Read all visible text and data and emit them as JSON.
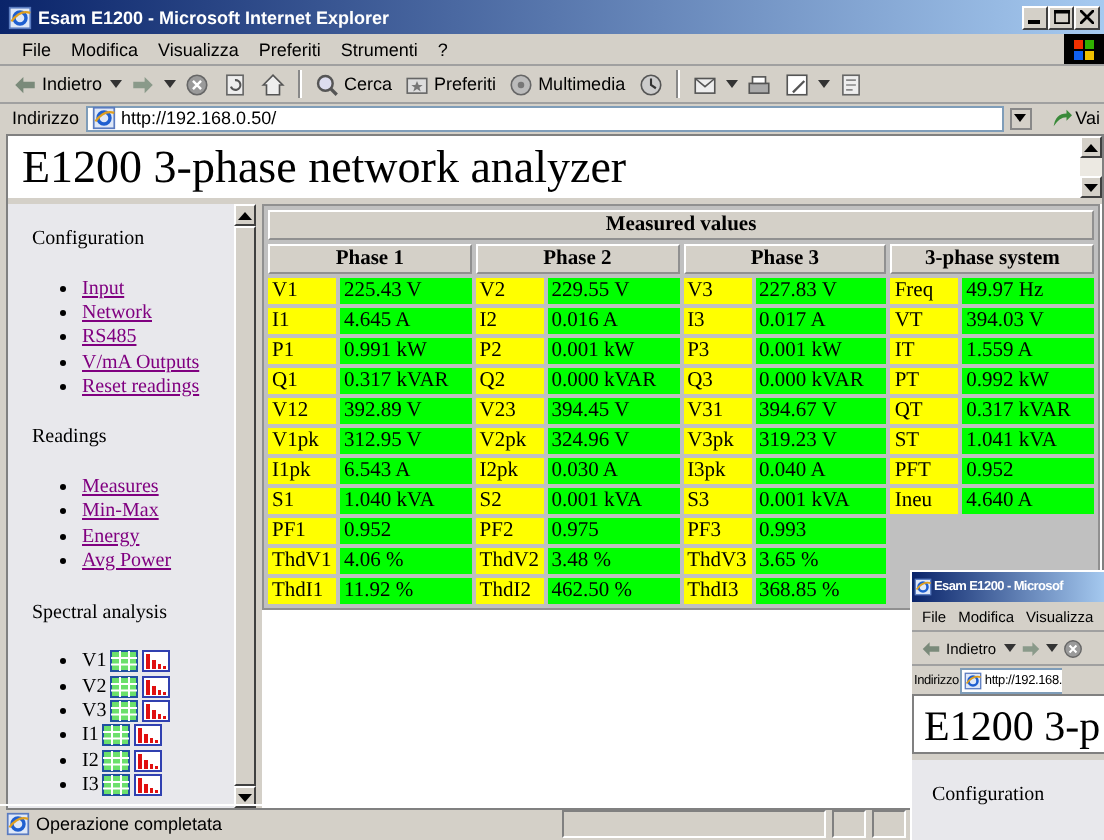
{
  "window": {
    "title": "Esam E1200 - Microsoft Internet Explorer",
    "menu": [
      "File",
      "Modifica",
      "Visualizza",
      "Preferiti",
      "Strumenti",
      "?"
    ],
    "toolbar": [
      {
        "kind": "back",
        "label": "Indietro"
      },
      {
        "kind": "forward"
      },
      {
        "kind": "stop"
      },
      {
        "kind": "refresh"
      },
      {
        "kind": "home"
      },
      {
        "kind": "search",
        "label": "Cerca"
      },
      {
        "kind": "favorites",
        "label": "Preferiti"
      },
      {
        "kind": "media",
        "label": "Multimedia"
      },
      {
        "kind": "history"
      },
      {
        "kind": "mail"
      },
      {
        "kind": "print"
      },
      {
        "kind": "edit"
      },
      {
        "kind": "discuss"
      }
    ],
    "address": {
      "label": "Indirizzo",
      "url": "http://192.168.0.50/",
      "go": "Vai"
    }
  },
  "page": {
    "heading": "E1200 3-phase network analyzer",
    "sidebar": [
      {
        "title": "Configuration",
        "links": [
          "Input",
          "Network",
          "RS485",
          "V/mA Outputs",
          "Reset readings"
        ]
      },
      {
        "title": "Readings",
        "links": [
          "Measures",
          "Min-Max",
          "Energy",
          "Avg Power"
        ]
      },
      {
        "title": "Spectral analysis",
        "channels": [
          "V1",
          "V2",
          "V3",
          "I1",
          "I2",
          "I3"
        ]
      }
    ],
    "table": {
      "title": "Measured values",
      "groups": [
        {
          "title": "Phase 1",
          "rows": [
            {
              "label": "V1",
              "value": "225.43 V"
            },
            {
              "label": "I1",
              "value": "4.645 A"
            },
            {
              "label": "P1",
              "value": "0.991 kW"
            },
            {
              "label": "Q1",
              "value": "0.317 kVAR"
            },
            {
              "label": "V12",
              "value": "392.89 V"
            },
            {
              "label": "V1pk",
              "value": "312.95 V"
            },
            {
              "label": "I1pk",
              "value": "6.543 A"
            },
            {
              "label": "S1",
              "value": "1.040 kVA"
            },
            {
              "label": "PF1",
              "value": "0.952"
            },
            {
              "label": "ThdV1",
              "value": "4.06 %"
            },
            {
              "label": "ThdI1",
              "value": "11.92 %"
            }
          ]
        },
        {
          "title": "Phase 2",
          "rows": [
            {
              "label": "V2",
              "value": "229.55 V"
            },
            {
              "label": "I2",
              "value": "0.016 A"
            },
            {
              "label": "P2",
              "value": "0.001 kW"
            },
            {
              "label": "Q2",
              "value": "0.000 kVAR"
            },
            {
              "label": "V23",
              "value": "394.45 V"
            },
            {
              "label": "V2pk",
              "value": "324.96 V"
            },
            {
              "label": "I2pk",
              "value": "0.030 A"
            },
            {
              "label": "S2",
              "value": "0.001 kVA"
            },
            {
              "label": "PF2",
              "value": "0.975"
            },
            {
              "label": "ThdV2",
              "value": "3.48 %"
            },
            {
              "label": "ThdI2",
              "value": "462.50 %"
            }
          ]
        },
        {
          "title": "Phase 3",
          "rows": [
            {
              "label": "V3",
              "value": "227.83 V"
            },
            {
              "label": "I3",
              "value": "0.017 A"
            },
            {
              "label": "P3",
              "value": "0.001 kW"
            },
            {
              "label": "Q3",
              "value": "0.000 kVAR"
            },
            {
              "label": "V31",
              "value": "394.67 V"
            },
            {
              "label": "V3pk",
              "value": "319.23 V"
            },
            {
              "label": "I3pk",
              "value": "0.040 A"
            },
            {
              "label": "S3",
              "value": "0.001 kVA"
            },
            {
              "label": "PF3",
              "value": "0.993"
            },
            {
              "label": "ThdV3",
              "value": "3.65 %"
            },
            {
              "label": "ThdI3",
              "value": "368.85 %"
            }
          ]
        },
        {
          "title": "3-phase system",
          "rows": [
            {
              "label": "Freq",
              "value": "49.97 Hz"
            },
            {
              "label": "VT",
              "value": "394.03 V"
            },
            {
              "label": "IT",
              "value": "1.559 A"
            },
            {
              "label": "PT",
              "value": "0.992 kW"
            },
            {
              "label": "QT",
              "value": "0.317 kVAR"
            },
            {
              "label": "ST",
              "value": "1.041 kVA"
            },
            {
              "label": "PFT",
              "value": "0.952"
            },
            {
              "label": "Ineu",
              "value": "4.640 A"
            }
          ]
        }
      ]
    }
  },
  "status_bar": {
    "text": "Operazione completata"
  },
  "second_window": {
    "title": "Esam E1200 - Microsof",
    "menu": [
      "File",
      "Modifica",
      "Visualizza"
    ],
    "back": "Indietro",
    "address_label": "Indirizzo",
    "url": "http://192.168.",
    "heading": "E1200 3-p",
    "sidebar_title": "Configuration"
  }
}
